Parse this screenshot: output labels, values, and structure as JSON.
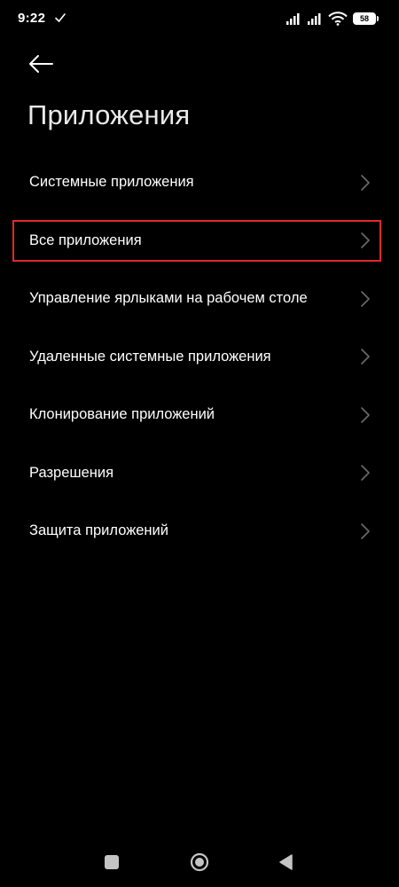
{
  "status_bar": {
    "time": "9:22",
    "battery": "58",
    "icons": [
      "check-icon",
      "signal-icon",
      "signal-icon",
      "wifi-icon",
      "battery-icon"
    ]
  },
  "header": {
    "back_icon": "arrow-left-icon",
    "title": "Приложения"
  },
  "list": {
    "items": [
      {
        "label": "Системные приложения",
        "icon": "chevron-right-icon"
      },
      {
        "label": "Все приложения",
        "icon": "chevron-right-icon",
        "highlighted": true
      },
      {
        "label": "Управление ярлыками на рабочем столе",
        "icon": "chevron-right-icon"
      },
      {
        "label": "Удаленные системные приложения",
        "icon": "chevron-right-icon"
      },
      {
        "label": "Клонирование приложений",
        "icon": "chevron-right-icon"
      },
      {
        "label": "Разрешения",
        "icon": "chevron-right-icon"
      },
      {
        "label": "Защита приложений",
        "icon": "chevron-right-icon"
      }
    ]
  },
  "nav_bar": {
    "icons": [
      "recents-square-icon",
      "home-circle-icon",
      "back-triangle-icon"
    ]
  },
  "colors": {
    "background": "#000000",
    "text": "#ffffff",
    "chevron": "#6b6b6b",
    "highlight_frame": "#e0282e"
  }
}
